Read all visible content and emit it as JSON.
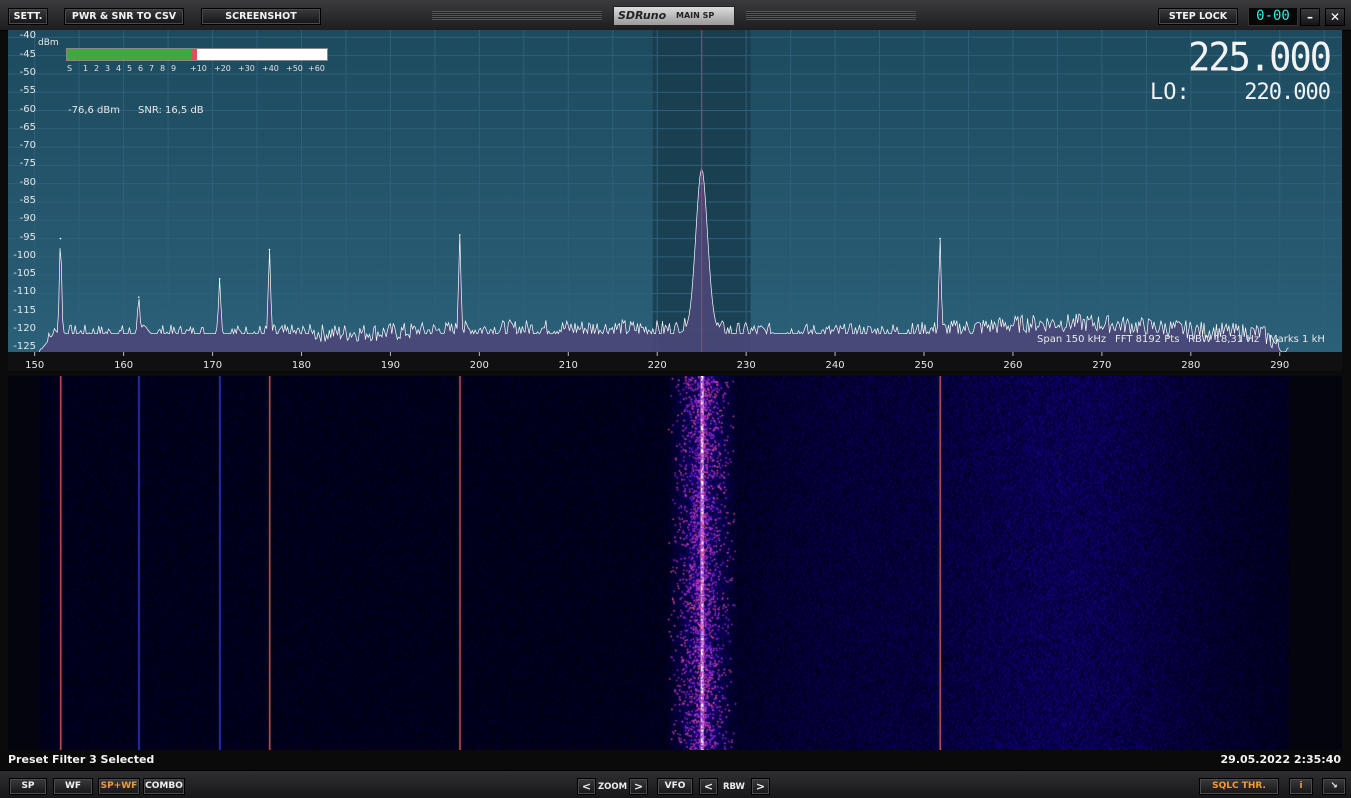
{
  "toolbar": {
    "settings_label": "SETT.",
    "csv_label": "PWR & SNR TO CSV",
    "screenshot_label": "SCREENSHOT",
    "logo_text": "SDRuno",
    "window_name": "MAIN SP",
    "step_lock_label": "STEP LOCK",
    "clock_display": "0-00",
    "minimize_icon": "minimize-icon",
    "close_icon": "close-icon"
  },
  "spectrum": {
    "unit_label": "dBm",
    "y_ticks": [
      "-40",
      "-45",
      "-50",
      "-55",
      "-60",
      "-65",
      "-70",
      "-75",
      "-80",
      "-85",
      "-90",
      "-95",
      "-100",
      "-105",
      "-110",
      "-115",
      "-120",
      "-125"
    ],
    "x_ticks": [
      "150",
      "160",
      "170",
      "180",
      "190",
      "200",
      "210",
      "220",
      "230",
      "240",
      "250",
      "260",
      "270",
      "280",
      "290"
    ],
    "meter_labels": [
      "S",
      "1",
      "2",
      "3",
      "4",
      "5",
      "6",
      "7",
      "8",
      "9",
      "+10",
      "+20",
      "+30",
      "+40",
      "+50",
      "+60"
    ],
    "meter_level_fraction": 0.5,
    "power_readout": "-76,6 dBm",
    "snr_readout": "SNR: 16,5 dB",
    "vfo_frequency": "225.000",
    "lo_label": "LO:",
    "lo_frequency": "220.000",
    "span_info": "Span 150 kHz",
    "fft_info": "FFT 8192 Pts",
    "rbw_info": "RBW 18,31 Hz",
    "marks_info": "Marks 1 kH",
    "colors": {
      "background": "#1f4a5c",
      "trace_fill": "#4a4778",
      "trace_line": "#ffffff",
      "grid": "#2f5f7a",
      "tuned_marker": "#e03030"
    }
  },
  "chart_data": {
    "type": "area",
    "xlabel": "",
    "ylabel": "dBm",
    "xlim": [
      147,
      297
    ],
    "ylim": [
      -126,
      -38
    ],
    "x_ticks": [
      150,
      160,
      170,
      180,
      190,
      200,
      210,
      220,
      230,
      240,
      250,
      260,
      270,
      280,
      290
    ],
    "y_ticks": [
      -40,
      -45,
      -50,
      -55,
      -60,
      -65,
      -70,
      -75,
      -80,
      -85,
      -90,
      -95,
      -100,
      -105,
      -110,
      -115,
      -120,
      -125
    ],
    "tuned_frequency": 225.0,
    "filter_band": [
      219.5,
      230.5
    ],
    "peaks": [
      {
        "x": 152.9,
        "y": -95
      },
      {
        "x": 161.7,
        "y": -111
      },
      {
        "x": 170.8,
        "y": -106
      },
      {
        "x": 176.4,
        "y": -98
      },
      {
        "x": 197.8,
        "y": -94
      },
      {
        "x": 225.0,
        "y": -80
      },
      {
        "x": 251.8,
        "y": -95
      }
    ],
    "noise_floor": -121,
    "grid": true
  },
  "status": {
    "message": "Preset Filter 3 Selected",
    "datetime": "29.05.2022 2:35:40"
  },
  "bottom": {
    "sp_label": "SP",
    "wf_label": "WF",
    "spwf_label": "SP+WF",
    "combo_label": "COMBO",
    "zoom_label": "ZOOM",
    "vfo_label": "VFO",
    "rbw_label": "RBW",
    "sqlc_label": "SQLC THR.",
    "info_label": "i",
    "prev_glyph": "<",
    "next_glyph": ">",
    "resize_glyph": "↘"
  }
}
